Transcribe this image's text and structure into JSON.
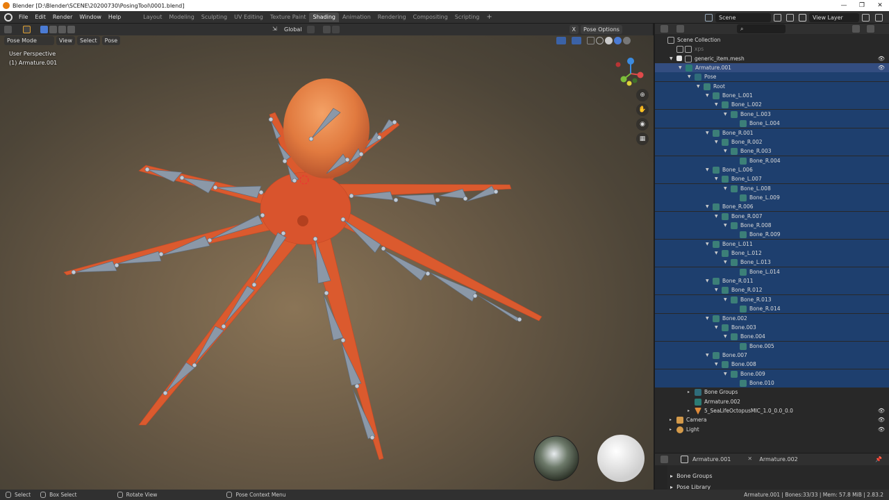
{
  "window": {
    "title": "Blender [D:\\Blender\\SCENE\\20200730\\PosingTool\\0001.blend]",
    "minimize": "—",
    "maximize": "❐",
    "close": "✕"
  },
  "menu": [
    "File",
    "Edit",
    "Render",
    "Window",
    "Help"
  ],
  "workspace_tabs": [
    {
      "label": "Layout",
      "active": false
    },
    {
      "label": "Modeling",
      "active": false
    },
    {
      "label": "Sculpting",
      "active": false
    },
    {
      "label": "UV Editing",
      "active": false
    },
    {
      "label": "Texture Paint",
      "active": false
    },
    {
      "label": "Shading",
      "active": true
    },
    {
      "label": "Animation",
      "active": false
    },
    {
      "label": "Rendering",
      "active": false
    },
    {
      "label": "Compositing",
      "active": false
    },
    {
      "label": "Scripting",
      "active": false
    }
  ],
  "tab_add": "+",
  "scene": {
    "label": "Scene",
    "view_layer": "View Layer"
  },
  "viewport_header": {
    "transform_orientation": "Global",
    "pose_options": "Pose Options",
    "x_toggle": "X"
  },
  "viewport_sub": {
    "mode": "Pose Mode",
    "view": "View",
    "select": "Select",
    "pose": "Pose"
  },
  "viewport_overlay": {
    "perspective": "User Perspective",
    "object": "(1) Armature.001"
  },
  "gizmo": {
    "x": "X",
    "y": "Y",
    "z": "Z"
  },
  "outliner": {
    "search_placeholder": "",
    "rows": [
      {
        "label": "Scene Collection",
        "depth": 0,
        "icon": "coll",
        "arrow": "",
        "state": ""
      },
      {
        "label": "xps",
        "depth": 1,
        "icon": "coll",
        "arrow": "",
        "state": "",
        "dim": true
      },
      {
        "label": "generic_item.mesh",
        "depth": 1,
        "icon": "coll",
        "arrow": "▼",
        "state": "",
        "eye": true
      },
      {
        "label": "Armature.001",
        "depth": 2,
        "icon": "arm",
        "arrow": "▼",
        "state": "active",
        "eye": true
      },
      {
        "label": "Pose",
        "depth": 3,
        "icon": "pose",
        "arrow": "▼",
        "state": "sel"
      },
      {
        "label": "Root",
        "depth": 4,
        "icon": "bone",
        "arrow": "▼",
        "state": "sel"
      },
      {
        "label": "Bone_L.001",
        "depth": 5,
        "icon": "bone",
        "arrow": "▼",
        "state": "sel"
      },
      {
        "label": "Bone_L.002",
        "depth": 6,
        "icon": "bone",
        "arrow": "▼",
        "state": "sel"
      },
      {
        "label": "Bone_L.003",
        "depth": 7,
        "icon": "bone",
        "arrow": "▼",
        "state": "sel"
      },
      {
        "label": "Bone_L.004",
        "depth": 8,
        "icon": "bone",
        "arrow": "",
        "state": "sel"
      },
      {
        "label": "Bone_R.001",
        "depth": 5,
        "icon": "bone",
        "arrow": "▼",
        "state": "sel"
      },
      {
        "label": "Bone_R.002",
        "depth": 6,
        "icon": "bone",
        "arrow": "▼",
        "state": "sel"
      },
      {
        "label": "Bone_R.003",
        "depth": 7,
        "icon": "bone",
        "arrow": "▼",
        "state": "sel"
      },
      {
        "label": "Bone_R.004",
        "depth": 8,
        "icon": "bone",
        "arrow": "",
        "state": "sel"
      },
      {
        "label": "Bone_L.006",
        "depth": 5,
        "icon": "bone",
        "arrow": "▼",
        "state": "sel"
      },
      {
        "label": "Bone_L.007",
        "depth": 6,
        "icon": "bone",
        "arrow": "▼",
        "state": "sel"
      },
      {
        "label": "Bone_L.008",
        "depth": 7,
        "icon": "bone",
        "arrow": "▼",
        "state": "sel"
      },
      {
        "label": "Bone_L.009",
        "depth": 8,
        "icon": "bone",
        "arrow": "",
        "state": "sel"
      },
      {
        "label": "Bone_R.006",
        "depth": 5,
        "icon": "bone",
        "arrow": "▼",
        "state": "sel"
      },
      {
        "label": "Bone_R.007",
        "depth": 6,
        "icon": "bone",
        "arrow": "▼",
        "state": "sel"
      },
      {
        "label": "Bone_R.008",
        "depth": 7,
        "icon": "bone",
        "arrow": "▼",
        "state": "sel"
      },
      {
        "label": "Bone_R.009",
        "depth": 8,
        "icon": "bone",
        "arrow": "",
        "state": "sel"
      },
      {
        "label": "Bone_L.011",
        "depth": 5,
        "icon": "bone",
        "arrow": "▼",
        "state": "sel"
      },
      {
        "label": "Bone_L.012",
        "depth": 6,
        "icon": "bone",
        "arrow": "▼",
        "state": "sel"
      },
      {
        "label": "Bone_L.013",
        "depth": 7,
        "icon": "bone",
        "arrow": "▼",
        "state": "sel"
      },
      {
        "label": "Bone_L.014",
        "depth": 8,
        "icon": "bone",
        "arrow": "",
        "state": "sel"
      },
      {
        "label": "Bone_R.011",
        "depth": 5,
        "icon": "bone",
        "arrow": "▼",
        "state": "sel"
      },
      {
        "label": "Bone_R.012",
        "depth": 6,
        "icon": "bone",
        "arrow": "▼",
        "state": "sel"
      },
      {
        "label": "Bone_R.013",
        "depth": 7,
        "icon": "bone",
        "arrow": "▼",
        "state": "sel"
      },
      {
        "label": "Bone_R.014",
        "depth": 8,
        "icon": "bone",
        "arrow": "",
        "state": "sel"
      },
      {
        "label": "Bone.002",
        "depth": 5,
        "icon": "bone",
        "arrow": "▼",
        "state": "sel"
      },
      {
        "label": "Bone.003",
        "depth": 6,
        "icon": "bone",
        "arrow": "▼",
        "state": "sel"
      },
      {
        "label": "Bone.004",
        "depth": 7,
        "icon": "bone",
        "arrow": "▼",
        "state": "sel"
      },
      {
        "label": "Bone.005",
        "depth": 8,
        "icon": "bone",
        "arrow": "",
        "state": "sel"
      },
      {
        "label": "Bone.007",
        "depth": 5,
        "icon": "bone",
        "arrow": "▼",
        "state": "sel"
      },
      {
        "label": "Bone.008",
        "depth": 6,
        "icon": "bone",
        "arrow": "▼",
        "state": "sel"
      },
      {
        "label": "Bone.009",
        "depth": 7,
        "icon": "bone",
        "arrow": "▼",
        "state": "sel"
      },
      {
        "label": "Bone.010",
        "depth": 8,
        "icon": "bone",
        "arrow": "",
        "state": "sel"
      },
      {
        "label": "Bone Groups",
        "depth": 3,
        "icon": "pose",
        "arrow": "▸",
        "state": ""
      },
      {
        "label": "Armature.002",
        "depth": 3,
        "icon": "arm",
        "arrow": "",
        "state": ""
      },
      {
        "label": "5_SeaLifeOctopusMIC_1.0_0.0_0.0",
        "depth": 3,
        "icon": "mesh",
        "arrow": "▸",
        "state": "",
        "eye": true
      },
      {
        "label": "Camera",
        "depth": 1,
        "icon": "cam",
        "arrow": "▸",
        "state": "",
        "eye": true
      },
      {
        "label": "Light",
        "depth": 1,
        "icon": "light",
        "arrow": "▸",
        "state": "",
        "eye": true
      }
    ]
  },
  "properties": {
    "armature_a": "Armature.001",
    "armature_b": "Armature.002",
    "sections": [
      "Bone Groups",
      "Pose Library"
    ]
  },
  "statusbar": {
    "select": "Select",
    "box_select": "Box Select",
    "rotate_view": "Rotate View",
    "pose_context": "Pose Context Menu",
    "info": "Armature.001 | Bones:33/33 | Mem: 57.8 MiB | 2.83.2"
  },
  "colors": {
    "selected_row": "#1e3f6e",
    "active_row": "#334d80",
    "octopus": "#d9542d",
    "bone": "#8b98a8"
  }
}
